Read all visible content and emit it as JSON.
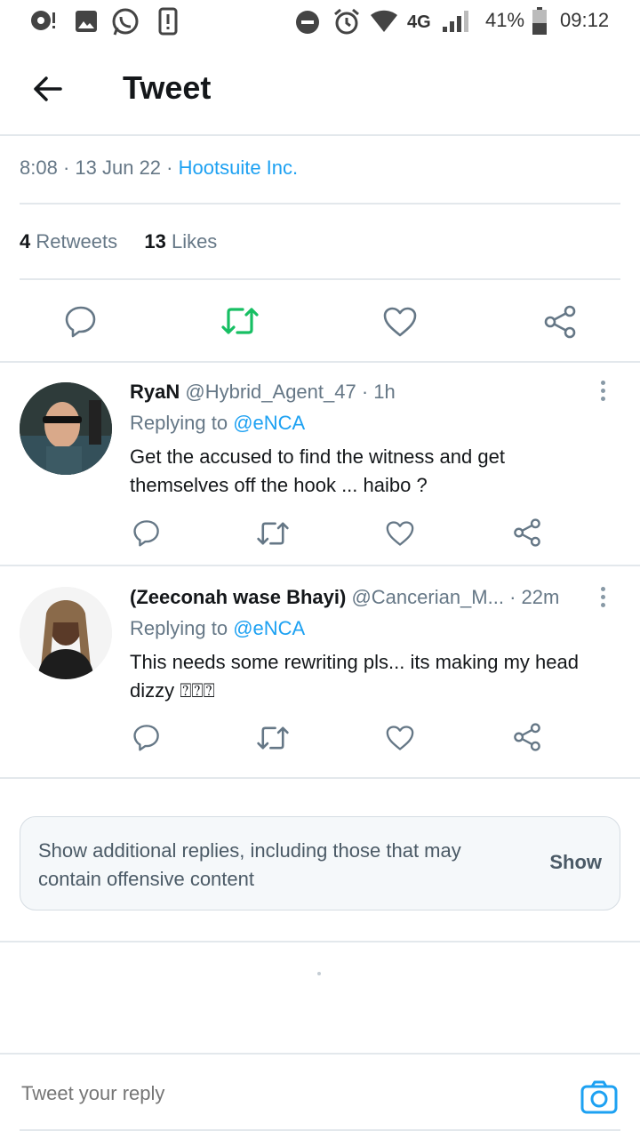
{
  "status_bar": {
    "battery": "41%",
    "time": "09:12",
    "network": "4G",
    "icons_left": [
      "notification-icon",
      "gallery-icon",
      "whatsapp-icon",
      "alert-icon"
    ],
    "icons_right": [
      "do-not-disturb-icon",
      "alarm-icon",
      "wifi-icon",
      "signal-icon",
      "battery-icon"
    ]
  },
  "header": {
    "title": "Tweet"
  },
  "tweet": {
    "time": "8:08",
    "date": "13 Jun 22",
    "source": "Hootsuite Inc.",
    "retweets_count": "4",
    "retweets_label": "Retweets",
    "likes_count": "13",
    "likes_label": "Likes",
    "retweet_active": true,
    "colors": {
      "accent": "#1da1f2",
      "retweet": "#17bf63",
      "muted": "#657786"
    }
  },
  "replies": [
    {
      "name": "RyaN",
      "handle": "@Hybrid_Agent_47",
      "time": "· 1h",
      "replying_prefix": "Replying to",
      "replying_to": "@eNCA",
      "text_line1": "Get the accused to find the witness and get",
      "text_line2": "themselves off the hook ... haibo ?"
    },
    {
      "name": "(Zeeconah wase Bhayi)",
      "handle": "@Cancerian_M...",
      "time": "· 22m",
      "replying_prefix": "Replying to",
      "replying_to": "@eNCA",
      "text_line1": "This needs some rewriting pls... its making my head",
      "text_line2": "dizzy ⍰⍰⍰"
    }
  ],
  "more_replies": {
    "text": "Show additional replies, including those that may contain offensive content",
    "button": "Show"
  },
  "reply_bar": {
    "placeholder": "Tweet your reply"
  }
}
